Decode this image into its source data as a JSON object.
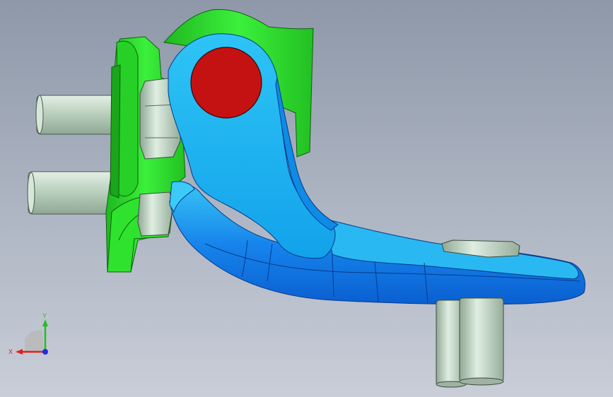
{
  "viewport": {
    "colors": {
      "bg_top": "#8e98a8",
      "bg_bottom": "#c9ced8",
      "bracket_green": "#2fe52f",
      "bracket_green_dark": "#1fa81f",
      "arm_blue": "#18b4f0",
      "arm_blue_dark": "#0a6fd8",
      "pin_red": "#c41212",
      "bolt_grey": "#c9dccb"
    }
  },
  "triad": {
    "x_label": "X",
    "y_label": "Y",
    "x_color": "#e0201a",
    "y_color": "#20c020",
    "z_color": "#1a30e0"
  }
}
